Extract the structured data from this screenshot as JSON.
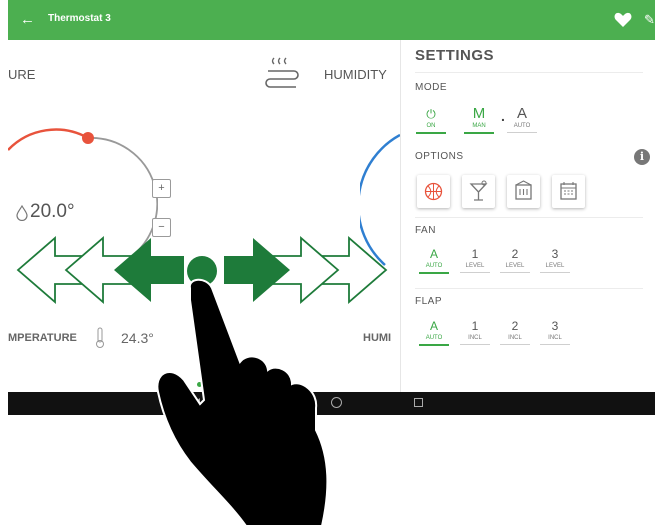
{
  "topbar": {
    "back_icon": "←",
    "title": "Thermostat 3",
    "heart_icon": "heart-icon",
    "edit_icon": "✎",
    "color": "#4caf50"
  },
  "main": {
    "temperature_label": "URE",
    "humidity_label": "HUMIDITY",
    "setpoint": "20.0°",
    "plus": "+",
    "minus": "−",
    "temperature_bottom_label": "MPERATURE",
    "temperature_value": "24.3°",
    "humidity_bottom_label": "HUMI"
  },
  "settings": {
    "title": "SETTINGS",
    "mode": {
      "label": "MODE",
      "items": [
        {
          "big": "⏻",
          "small": "ON",
          "active": true
        },
        {
          "big": "M",
          "small": "MAN",
          "active": true
        },
        {
          "big": "A",
          "small": "AUTO",
          "active": false
        }
      ],
      "dot": "."
    },
    "options": {
      "label": "OPTIONS",
      "info": "i"
    },
    "fan": {
      "label": "FAN",
      "items": [
        {
          "big": "A",
          "small": "AUTO",
          "active": true
        },
        {
          "big": "1",
          "small": "LEVEL",
          "active": false
        },
        {
          "big": "2",
          "small": "LEVEL",
          "active": false
        },
        {
          "big": "3",
          "small": "LEVEL",
          "active": false
        }
      ]
    },
    "flap": {
      "label": "FLAP",
      "items": [
        {
          "big": "A",
          "small": "AUTO",
          "active": true
        },
        {
          "big": "1",
          "small": "INCL",
          "active": false
        },
        {
          "big": "2",
          "small": "INCL",
          "active": false
        },
        {
          "big": "3",
          "small": "INCL",
          "active": false
        }
      ]
    }
  },
  "colors": {
    "accent": "#3aa745",
    "heat_arc": "#e8533c",
    "humidity_arc": "#2f7fd1",
    "arrow": "#1e7b3a"
  }
}
